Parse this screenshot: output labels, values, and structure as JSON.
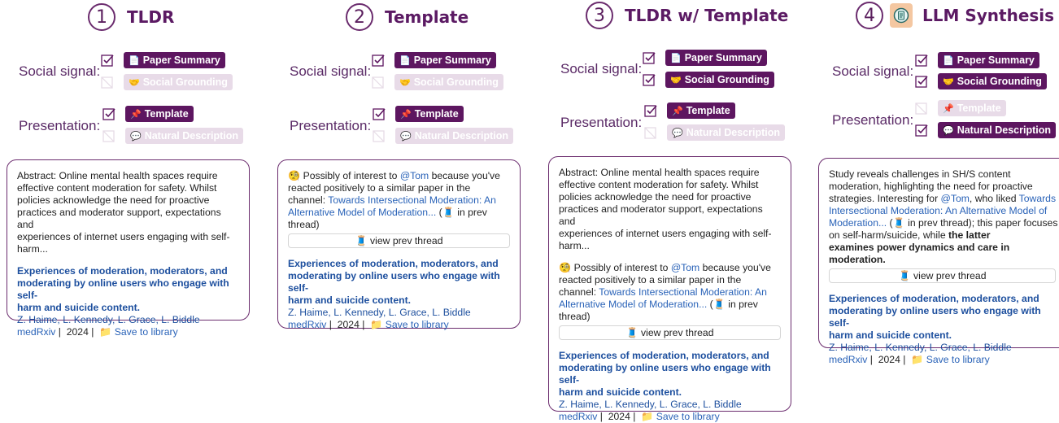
{
  "labels": {
    "social_signal": "Social signal:",
    "presentation": "Presentation:"
  },
  "chips": {
    "paper_summary": "Paper Summary",
    "social_grounding": "Social Grounding",
    "template": "Template",
    "natural_description": "Natural Description"
  },
  "columns": [
    {
      "number": "1",
      "title": "TLDR"
    },
    {
      "number": "2",
      "title": "Template"
    },
    {
      "number": "3",
      "title": "TLDR w/ Template"
    },
    {
      "number": "4",
      "title": "LLM Synthesis"
    }
  ],
  "abstract": {
    "lines": [
      "Abstract: Online mental health spaces require",
      "effective content moderation for safety. Whilst",
      "policies acknowledge the need for proactive",
      "practices and moderator support, expectations and",
      "experiences of internet users engaging with self-",
      "harm..."
    ]
  },
  "template_text": {
    "intro_pre": "Possibly of interest to ",
    "mention": "@Tom",
    "intro_post": " because you've",
    "line2": "reacted positively to a similar paper in the",
    "line3_pre": "channel: ",
    "line3_link": "Towards Intersectional Moderation: An",
    "line4_link": "Alternative Model of Moderation...",
    "line4_post": " (🧵 in prev",
    "line5": "thread)"
  },
  "view_prev": "🧵 view prev thread",
  "paper": {
    "title_lines": [
      "Experiences of moderation, moderators, and",
      "moderating by online users who engage with self-",
      "harm and suicide content."
    ],
    "authors": "Z. Haime, L. Kennedy, L. Grace, L. Biddle",
    "venue": "medRxiv",
    "year": "2024",
    "save": "Save to library"
  },
  "llm_text": {
    "l1": "Study reveals challenges in SH/S content",
    "l2": "moderation, highlighting the need for proactive",
    "l3_pre": "strategies. Interesting for ",
    "l3_mention": "@Tom",
    "l3_mid": ", who liked ",
    "l3_link": "Towards",
    "l4_link": "Intersectional Moderation: An Alternative Model of",
    "l5_link": "Moderation...",
    "l5_post": " (🧵 in prev thread); this paper focuses",
    "l6_pre": "on self-harm/suicide, while ",
    "l6_bold": "the latter",
    "l7_bold": "examines power dynamics and care in moderation."
  },
  "colors": {
    "accent": "#5d1660",
    "chip_off": "#e8dbe8",
    "link": "#2a63b8"
  }
}
